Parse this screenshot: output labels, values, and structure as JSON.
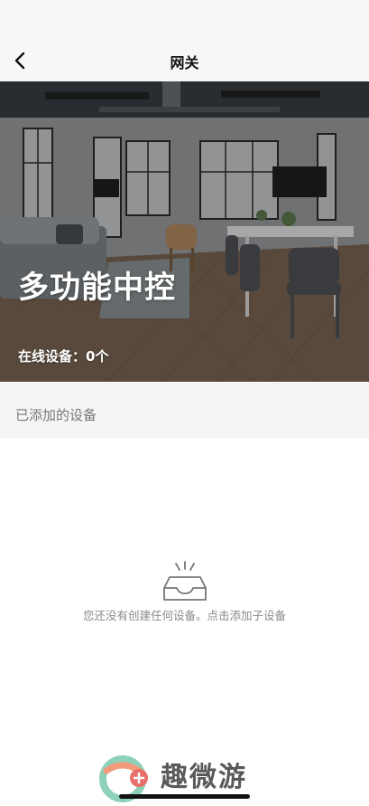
{
  "nav": {
    "back_icon": "chevron-left-icon",
    "title": "网关"
  },
  "hero": {
    "title": "多功能中控",
    "status": "在线设备：0个"
  },
  "devices": {
    "section_label": "已添加的设备",
    "empty_icon": "empty-tray-icon",
    "empty_message": "您还没有创建任何设备。点击添加子设备"
  },
  "watermark": {
    "text": "趣微游"
  },
  "colors": {
    "nav_background": "#f7f7f7",
    "section_background": "#f5f5f5",
    "hero_text": "#ffffff",
    "muted_text": "#8a8a8a"
  }
}
